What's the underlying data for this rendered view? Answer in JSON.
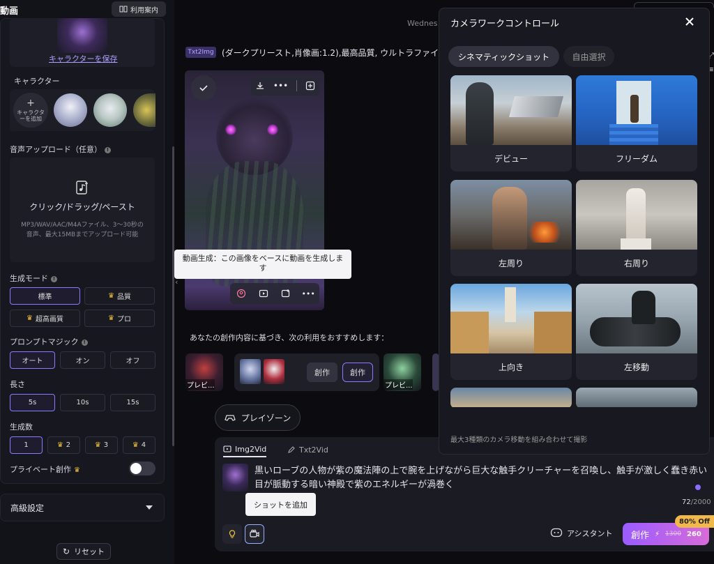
{
  "sidebar": {
    "title": "動画",
    "guide_label": "利用案内",
    "save_character": "キャラクターを保存",
    "character_label": "キャラクター",
    "add_character": "キャラクターを追加",
    "audio_upload_label": "音声アップロード（任意）",
    "upload_main": "クリック/ドラッグ/ペースト",
    "upload_hint": "MP3/WAV/AAC/M4Aファイル、3〜30秒の音声、最大15MBまでアップロード可能",
    "gen_mode_label": "生成モード",
    "gen_modes": [
      {
        "label": "標準",
        "selected": true,
        "premium": false
      },
      {
        "label": "品質",
        "selected": false,
        "premium": true
      },
      {
        "label": "超高画質",
        "selected": false,
        "premium": true
      },
      {
        "label": "プロ",
        "selected": false,
        "premium": true
      }
    ],
    "prompt_magic_label": "プロンプトマジック",
    "prompt_magic": [
      {
        "label": "オート",
        "selected": true
      },
      {
        "label": "オン",
        "selected": false
      },
      {
        "label": "オフ",
        "selected": false
      }
    ],
    "length_label": "長さ",
    "lengths": [
      {
        "label": "5s",
        "selected": true
      },
      {
        "label": "10s",
        "selected": false
      },
      {
        "label": "15s",
        "selected": false
      }
    ],
    "count_label": "生成数",
    "counts": [
      {
        "label": "1",
        "selected": true,
        "premium": false
      },
      {
        "label": "2",
        "selected": false,
        "premium": true
      },
      {
        "label": "3",
        "selected": false,
        "premium": true
      },
      {
        "label": "4",
        "selected": false,
        "premium": true
      }
    ],
    "private_label": "プライベート創作",
    "advanced_label": "高級設定",
    "reset_label": "リセット"
  },
  "main": {
    "date_partial": "Wednes",
    "prompt_tag": "Txt2Img",
    "prompt_text": "(ダークプリースト,肖像画:1.2),最高品質, ウルトラファイン,",
    "tooltip_video": "動画生成：この画像をベースに動画を生成します",
    "recommend_text": "あなたの創作内容に基づき、次の利用をおすすめします：",
    "reco_preview_label": "プレビ...",
    "create_chip_1": "創作",
    "create_chip_2": "創作",
    "playzone_label": "プレイゾーン"
  },
  "composer": {
    "tab_img2vid": "Img2Vid",
    "tab_txt2vid": "Txt2Vid",
    "text": "黒いローブの人物が紫の魔法陣の上で腕を上げながら巨大な触手クリーチャーを召喚し、触手が激しく蠢き赤い目が脈動する暗い神殿で紫のエネルギーが渦巻く",
    "count_current": "72",
    "count_max": "/2000",
    "shot_tooltip": "ショットを追加",
    "assistant_label": "アシスタント",
    "create_label": "創作",
    "price_original": "1300",
    "price_now": "260",
    "discount_badge": "80% Off"
  },
  "camera_panel": {
    "title": "カメラワークコントロール",
    "tabs": [
      {
        "label": "シネマティックショット",
        "active": true
      },
      {
        "label": "自由選択",
        "active": false
      }
    ],
    "shots": [
      {
        "label": "デビュー"
      },
      {
        "label": "フリーダム"
      },
      {
        "label": "左周り"
      },
      {
        "label": "右周り"
      },
      {
        "label": "上向き"
      },
      {
        "label": "左移動"
      }
    ],
    "footer": "最大3種類のカメラ移動を組み合わせて撮影"
  }
}
